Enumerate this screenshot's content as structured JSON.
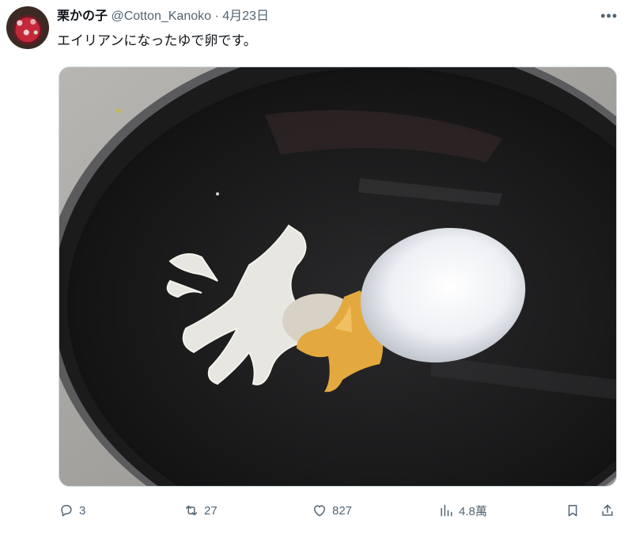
{
  "tweet": {
    "display_name": "栗かの子",
    "handle": "@Cotton_Kanoko",
    "separator": "·",
    "date": "4月23日",
    "text": "エイリアンになったゆで卵です。",
    "more_icon": "more-horizontal-icon"
  },
  "actions": {
    "reply_count": "3",
    "retweet_count": "27",
    "like_count": "827",
    "views_count": "4.8萬"
  },
  "icons": {
    "reply": "reply-icon",
    "retweet": "retweet-icon",
    "like": "heart-icon",
    "views": "views-chart-icon",
    "bookmark": "bookmark-icon",
    "share": "share-icon"
  },
  "colors": {
    "text_primary": "#0f1419",
    "text_secondary": "#536471",
    "border": "#cfd9de"
  }
}
